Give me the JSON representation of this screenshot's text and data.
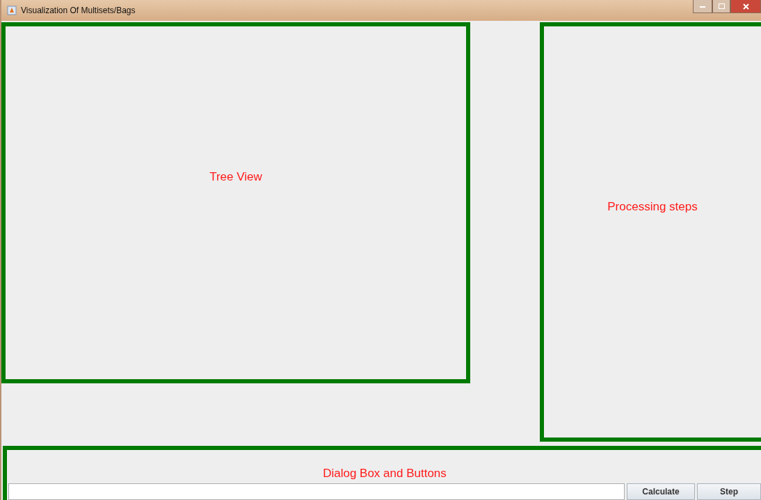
{
  "window": {
    "title": "Visualization Of Multisets/Bags"
  },
  "panels": [
    {
      "kind": "tree",
      "label": "Tree View"
    },
    {
      "kind": "steps",
      "label": "Processing steps"
    }
  ],
  "dialog": {
    "label": "Dialog Box and Buttons",
    "buttons": [
      "Calculate",
      "Step"
    ]
  }
}
